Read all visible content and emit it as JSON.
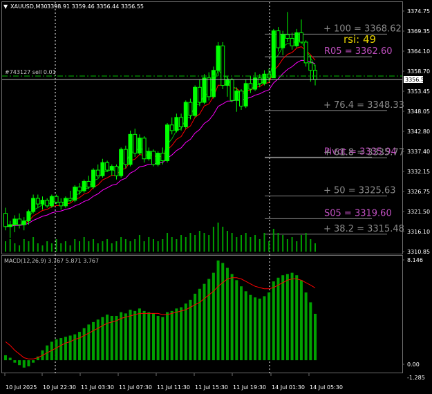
{
  "header": {
    "symbol": "XAUUSD,M30",
    "ohlc": "3398.91 3359.46 3356.44 3356.55"
  },
  "order_label": "#743127 sell 0.01",
  "current_price": "3356.55",
  "indicator_rsi": "rsi: 49",
  "levels": [
    {
      "text": "+ 100  = 3368.62",
      "price": 3368.62,
      "color": "#8c8c8c"
    },
    {
      "text": "R05 = 3362.60",
      "price": 3362.6,
      "color": "#c050c0"
    },
    {
      "text": "+ 76.4  = 3348.33",
      "price": 3348.33,
      "color": "#8c8c8c"
    },
    {
      "text": "Pivot = 3335.94",
      "price": 3335.94,
      "color": "#c050c0"
    },
    {
      "text": "+ 61.8  = 3335.77",
      "price": 3335.77,
      "color": "#8c8c8c"
    },
    {
      "text": "+ 50  = 3325.63",
      "price": 3325.63,
      "color": "#8c8c8c"
    },
    {
      "text": "S05 = 3319.60",
      "price": 3319.6,
      "color": "#c050c0"
    },
    {
      "text": "+ 38.2  = 3315.48",
      "price": 3315.48,
      "color": "#8c8c8c"
    }
  ],
  "price_axis": [
    "3374.75",
    "3369.35",
    "3364.10",
    "3358.70",
    "3353.45",
    "3348.05",
    "3342.80",
    "3337.40",
    "3332.15",
    "3326.75",
    "3321.50",
    "3316.10",
    "3310.85"
  ],
  "macd": {
    "label": "MACD(12,26,9) 3.767 5.871 3.767",
    "axis": [
      "8.146",
      "0.00",
      "-1.285"
    ]
  },
  "time_axis": [
    "10 Jul 2025",
    "10 Jul 22:30",
    "11 Jul 03:30",
    "11 Jul 07:30",
    "11 Jul 11:30",
    "11 Jul 15:30",
    "11 Jul 19:30",
    "14 Jul 01:30",
    "14 Jul 05:30"
  ],
  "colors": {
    "bull": "#00ff00",
    "bear": "#000000",
    "ma_fast": "#00c000",
    "ma_mid": "#ff0000",
    "ma_slow": "#ff00ff",
    "macd_hist": "#00a000",
    "macd_signal": "#ff0000",
    "grid_vline": "#ffffff"
  },
  "chart_data": {
    "type": "candlestick",
    "symbol": "XAUUSD",
    "timeframe": "M30",
    "ylim": [
      3310.85,
      3374.75
    ],
    "candles": [
      [
        3321.0,
        3322.5,
        3316.5,
        3317.5
      ],
      [
        3317.5,
        3319.0,
        3314.5,
        3318.0
      ],
      [
        3318.0,
        3320.5,
        3316.0,
        3319.5
      ],
      [
        3319.5,
        3321.0,
        3317.0,
        3318.0
      ],
      [
        3318.0,
        3320.0,
        3316.5,
        3319.0
      ],
      [
        3319.0,
        3322.0,
        3318.0,
        3321.5
      ],
      [
        3321.5,
        3326.0,
        3321.0,
        3325.0
      ],
      [
        3325.0,
        3326.0,
        3322.5,
        3323.5
      ],
      [
        3323.5,
        3325.5,
        3322.0,
        3324.5
      ],
      [
        3324.5,
        3325.0,
        3322.5,
        3323.0
      ],
      [
        3323.0,
        3326.0,
        3322.5,
        3325.5
      ],
      [
        3325.5,
        3326.0,
        3323.5,
        3324.0
      ],
      [
        3324.0,
        3325.0,
        3322.0,
        3323.0
      ],
      [
        3323.0,
        3325.5,
        3322.5,
        3325.0
      ],
      [
        3325.0,
        3327.0,
        3324.0,
        3324.5
      ],
      [
        3324.5,
        3328.5,
        3324.0,
        3328.0
      ],
      [
        3328.0,
        3329.0,
        3326.0,
        3327.0
      ],
      [
        3327.0,
        3330.0,
        3326.5,
        3329.5
      ],
      [
        3329.5,
        3331.0,
        3327.5,
        3328.0
      ],
      [
        3328.0,
        3333.0,
        3327.5,
        3332.5
      ],
      [
        3332.5,
        3334.0,
        3330.5,
        3331.0
      ],
      [
        3331.0,
        3335.5,
        3330.5,
        3334.5
      ],
      [
        3334.5,
        3335.0,
        3332.0,
        3332.5
      ],
      [
        3332.5,
        3334.0,
        3331.0,
        3333.5
      ],
      [
        3333.5,
        3334.0,
        3330.0,
        3331.0
      ],
      [
        3331.0,
        3338.5,
        3330.5,
        3338.0
      ],
      [
        3338.0,
        3339.0,
        3333.0,
        3334.0
      ],
      [
        3334.0,
        3343.0,
        3333.5,
        3342.0
      ],
      [
        3342.0,
        3343.5,
        3336.0,
        3337.0
      ],
      [
        3337.0,
        3342.0,
        3336.5,
        3341.0
      ],
      [
        3341.0,
        3341.5,
        3334.5,
        3335.5
      ],
      [
        3335.5,
        3338.5,
        3335.0,
        3337.5
      ],
      [
        3337.5,
        3338.0,
        3333.5,
        3334.0
      ],
      [
        3334.0,
        3337.5,
        3333.5,
        3337.0
      ],
      [
        3337.0,
        3338.5,
        3334.0,
        3335.0
      ],
      [
        3335.0,
        3345.0,
        3334.5,
        3344.5
      ],
      [
        3344.5,
        3346.5,
        3342.0,
        3343.0
      ],
      [
        3343.0,
        3347.5,
        3342.5,
        3346.5
      ],
      [
        3346.5,
        3347.5,
        3343.0,
        3344.0
      ],
      [
        3344.0,
        3351.0,
        3343.5,
        3350.5
      ],
      [
        3350.5,
        3351.5,
        3346.0,
        3347.0
      ],
      [
        3347.0,
        3355.0,
        3346.5,
        3354.5
      ],
      [
        3354.5,
        3356.5,
        3349.5,
        3350.5
      ],
      [
        3350.5,
        3358.0,
        3350.0,
        3357.0
      ],
      [
        3357.0,
        3358.5,
        3351.0,
        3352.0
      ],
      [
        3352.0,
        3360.0,
        3351.5,
        3359.0
      ],
      [
        3359.0,
        3366.5,
        3357.5,
        3365.5
      ],
      [
        3365.5,
        3366.5,
        3354.0,
        3355.0
      ],
      [
        3355.0,
        3357.5,
        3352.0,
        3356.5
      ],
      [
        3356.5,
        3357.0,
        3350.5,
        3351.0
      ],
      [
        3351.0,
        3354.5,
        3348.0,
        3353.5
      ],
      [
        3353.5,
        3354.0,
        3348.5,
        3349.5
      ],
      [
        3349.5,
        3356.5,
        3349.0,
        3355.5
      ],
      [
        3355.5,
        3357.5,
        3353.0,
        3354.0
      ],
      [
        3354.0,
        3358.5,
        3353.5,
        3357.0
      ],
      [
        3357.0,
        3358.0,
        3354.5,
        3355.5
      ],
      [
        3355.5,
        3359.0,
        3355.0,
        3358.0
      ],
      [
        3358.0,
        3359.5,
        3356.0,
        3357.0
      ],
      [
        3357.0,
        3370.0,
        3362.0,
        3369.5
      ],
      [
        3369.5,
        3370.5,
        3364.0,
        3365.0
      ],
      [
        3365.0,
        3369.5,
        3363.0,
        3368.5
      ],
      [
        3368.5,
        3374.5,
        3366.5,
        3367.5
      ],
      [
        3367.5,
        3369.0,
        3364.5,
        3365.5
      ],
      [
        3365.5,
        3370.0,
        3365.0,
        3369.0
      ],
      [
        3369.0,
        3372.5,
        3366.0,
        3366.5
      ],
      [
        3366.5,
        3367.0,
        3360.0,
        3361.0
      ],
      [
        3361.0,
        3363.0,
        3356.0,
        3359.0
      ],
      [
        3359.0,
        3360.5,
        3355.0,
        3356.55
      ]
    ],
    "volume": [
      5,
      6,
      4,
      3,
      6,
      5,
      7,
      4,
      3,
      5,
      4,
      6,
      4,
      5,
      3,
      6,
      5,
      7,
      5,
      6,
      4,
      5,
      6,
      4,
      5,
      7,
      6,
      5,
      6,
      8,
      5,
      7,
      6,
      5,
      6,
      9,
      7,
      6,
      8,
      7,
      9,
      8,
      10,
      9,
      8,
      12,
      14,
      12,
      10,
      9,
      7,
      8,
      9,
      7,
      8,
      6,
      9,
      5,
      11,
      9,
      8,
      6,
      7,
      5,
      8,
      9,
      6,
      4
    ],
    "macd": {
      "histogram": [
        0.4,
        0.2,
        -0.2,
        -0.4,
        -0.6,
        -0.5,
        -0.2,
        0.3,
        0.8,
        1.2,
        1.5,
        1.7,
        1.8,
        1.9,
        2.0,
        2.1,
        2.3,
        2.6,
        2.9,
        3.1,
        3.3,
        3.5,
        3.7,
        3.6,
        3.6,
        3.9,
        3.8,
        4.1,
        4.0,
        4.2,
        4.0,
        3.9,
        3.8,
        3.6,
        3.5,
        3.9,
        4.0,
        4.2,
        4.3,
        4.6,
        4.9,
        5.4,
        5.8,
        6.2,
        6.6,
        7.1,
        8.1,
        7.9,
        7.5,
        7.0,
        6.5,
        6.0,
        5.6,
        5.3,
        5.1,
        5.0,
        5.2,
        5.5,
        6.4,
        6.7,
        6.9,
        7.0,
        7.1,
        6.9,
        6.5,
        5.5,
        4.7,
        3.77
      ],
      "signal": [
        1.5,
        1.2,
        0.8,
        0.5,
        0.2,
        0.1,
        0.1,
        0.2,
        0.4,
        0.6,
        0.8,
        1.0,
        1.2,
        1.4,
        1.5,
        1.7,
        1.8,
        2.0,
        2.2,
        2.4,
        2.6,
        2.8,
        3.0,
        3.1,
        3.2,
        3.4,
        3.5,
        3.6,
        3.7,
        3.8,
        3.8,
        3.8,
        3.8,
        3.8,
        3.7,
        3.7,
        3.8,
        3.9,
        4.0,
        4.1,
        4.3,
        4.5,
        4.7,
        5.0,
        5.3,
        5.6,
        6.0,
        6.3,
        6.6,
        6.7,
        6.7,
        6.6,
        6.4,
        6.2,
        6.0,
        5.9,
        5.8,
        5.8,
        5.9,
        6.1,
        6.3,
        6.5,
        6.6,
        6.6,
        6.5,
        6.3,
        6.1,
        5.87
      ],
      "ylim": [
        -1.285,
        8.146
      ]
    }
  }
}
